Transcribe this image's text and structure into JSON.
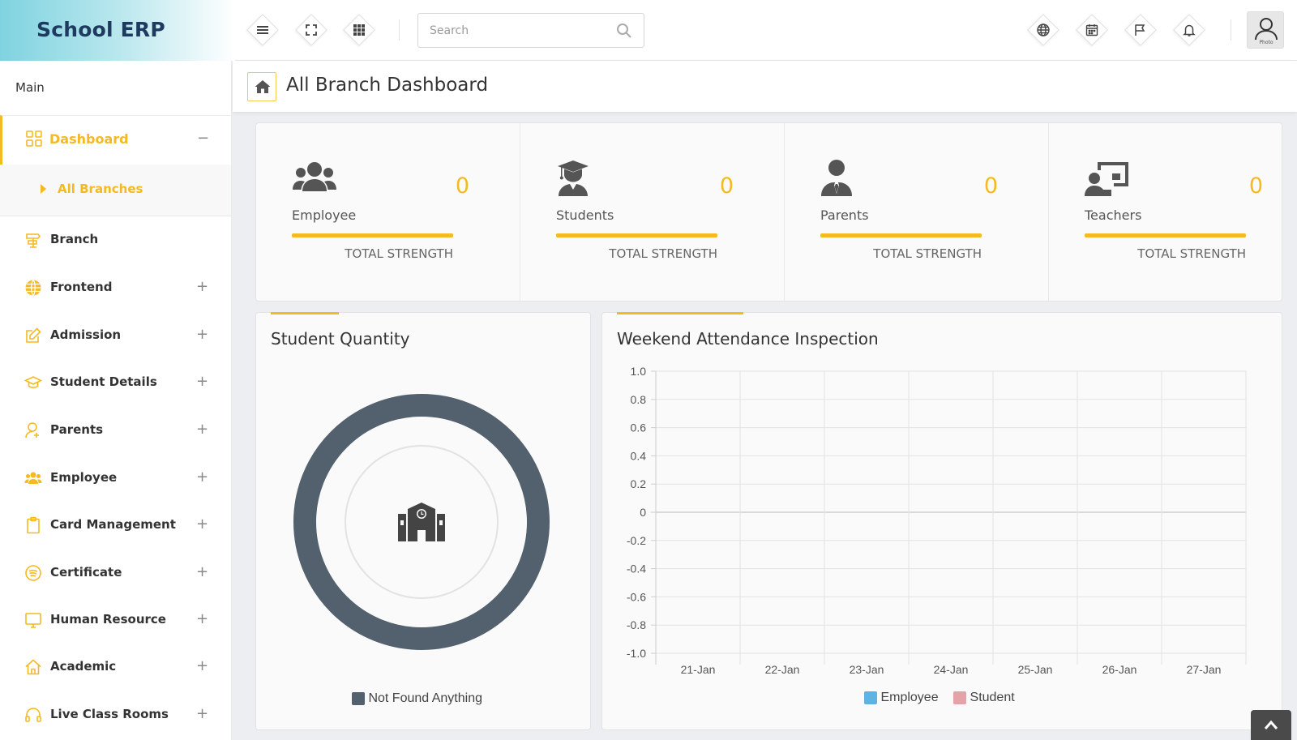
{
  "header": {
    "brand": "School ERP",
    "search_placeholder": "Search",
    "avatar_label": "Photo"
  },
  "sidebar": {
    "section_label": "Main",
    "active_item": "Dashboard",
    "active_sub_item": "All Branches",
    "items": [
      {
        "label": "Branch",
        "icon": "signpost-icon",
        "expandable": false
      },
      {
        "label": "Frontend",
        "icon": "globe-icon",
        "expandable": true
      },
      {
        "label": "Admission",
        "icon": "edit-icon",
        "expandable": true
      },
      {
        "label": "Student Details",
        "icon": "graduation-cap-icon",
        "expandable": true
      },
      {
        "label": "Parents",
        "icon": "user-icon",
        "expandable": true
      },
      {
        "label": "Employee",
        "icon": "users-icon",
        "expandable": true
      },
      {
        "label": "Card Management",
        "icon": "clipboard-icon",
        "expandable": true
      },
      {
        "label": "Certificate",
        "icon": "certificate-icon",
        "expandable": true
      },
      {
        "label": "Human Resource",
        "icon": "monitor-icon",
        "expandable": true
      },
      {
        "label": "Academic",
        "icon": "home-icon",
        "expandable": true
      },
      {
        "label": "Live Class Rooms",
        "icon": "headset-icon",
        "expandable": true
      }
    ]
  },
  "page": {
    "title": "All Branch Dashboard"
  },
  "stats": [
    {
      "name": "Employee",
      "value": "0",
      "sub": "TOTAL STRENGTH",
      "icon": "users-icon"
    },
    {
      "name": "Students",
      "value": "0",
      "sub": "TOTAL STRENGTH",
      "icon": "graduate-icon"
    },
    {
      "name": "Parents",
      "value": "0",
      "sub": "TOTAL STRENGTH",
      "icon": "parent-icon"
    },
    {
      "name": "Teachers",
      "value": "0",
      "sub": "TOTAL STRENGTH",
      "icon": "teacher-icon"
    }
  ],
  "student_quantity": {
    "title": "Student Quantity",
    "legend": "Not Found Anything",
    "ring_color": "#52616d"
  },
  "chart_data": {
    "type": "line",
    "title": "Weekend Attendance Inspection",
    "categories": [
      "21-Jan",
      "22-Jan",
      "23-Jan",
      "24-Jan",
      "25-Jan",
      "26-Jan",
      "27-Jan"
    ],
    "ylim": [
      -1.0,
      1.0
    ],
    "yticks": [
      "1.0",
      "0.8",
      "0.6",
      "0.4",
      "0.2",
      "0",
      "-0.2",
      "-0.4",
      "-0.6",
      "-0.8",
      "-1.0"
    ],
    "series": [
      {
        "name": "Employee",
        "color": "#5fb3e3",
        "values": []
      },
      {
        "name": "Student",
        "color": "#e3a3a8",
        "values": []
      }
    ],
    "grid": true,
    "legend_position": "bottom"
  },
  "colors": {
    "accent": "#f5b922",
    "brand_text": "#1e3a5f"
  }
}
